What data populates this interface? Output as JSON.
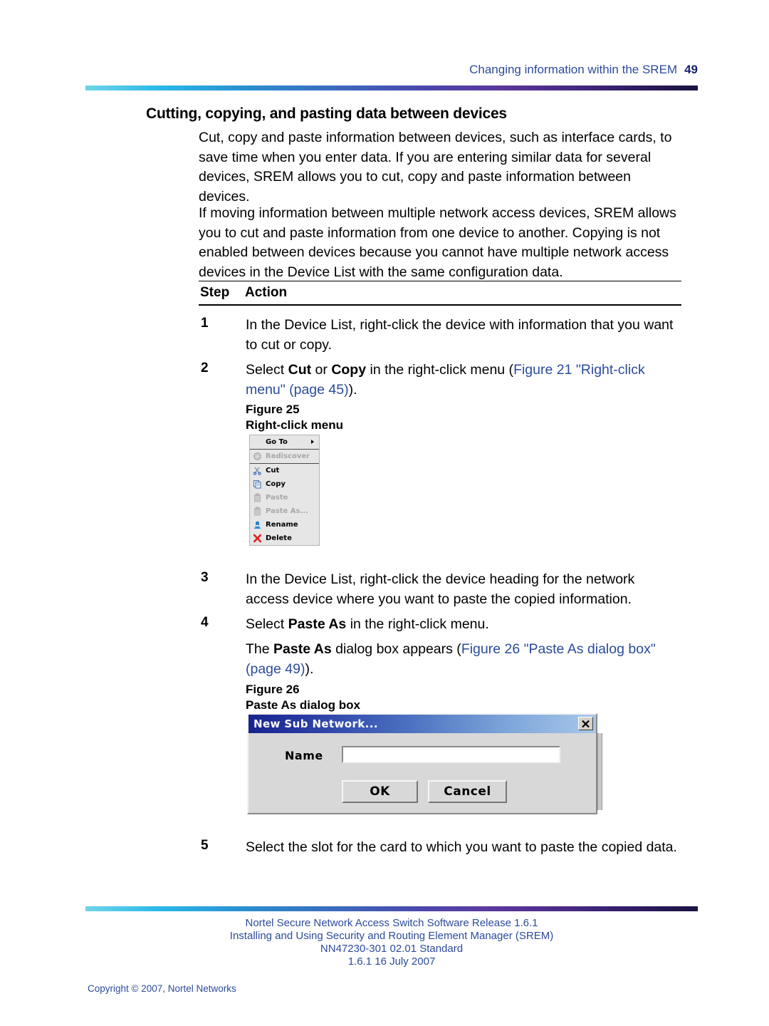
{
  "header": {
    "title": "Changing information within the SREM",
    "page_number": "49"
  },
  "section": {
    "title": "Cutting, copying, and pasting data between devices",
    "paragraph_1": "Cut, copy and paste information between devices, such as interface cards, to save time when you enter data. If you are entering similar data for several devices, SREM allows you to cut, copy and paste information between devices.",
    "paragraph_2": "If moving information between multiple network access devices, SREM allows you to cut and paste information from one device to another. Copying is not enabled between devices because you cannot have multiple network access devices in the Device List with the same configuration data."
  },
  "table": {
    "header_step": "Step",
    "header_action": "Action",
    "steps": [
      {
        "number": "1",
        "text": "In the Device List, right-click the device with information that you want to cut or copy."
      },
      {
        "number": "2",
        "text_lead": "Select ",
        "bold_1": "Cut",
        "text_mid": " or ",
        "bold_2": "Copy",
        "text_tail": " in the right-click menu (",
        "xref": "Figure 21 \"Right-click menu\" (page 45)",
        "text_end": ")."
      },
      {
        "number": "3",
        "text": "In the Device List, right-click the device heading for the network access device where you want to paste the copied information."
      },
      {
        "number": "4",
        "text_lead": "Select ",
        "bold_1": "Paste As",
        "text_tail": " in the right-click menu.",
        "extra_lead": "The ",
        "extra_bold": "Paste As",
        "extra_mid": " dialog box appears (",
        "extra_xref": "Figure 26 \"Paste As dialog box\" (page 49)",
        "extra_end": ")."
      },
      {
        "number": "5",
        "text": "Select the slot for the card to which you want to paste the copied data."
      }
    ]
  },
  "figure_25": {
    "label": "Figure 25",
    "title": "Right-click menu",
    "menu_items": [
      {
        "label": "Go To",
        "icon": "submenu-arrow-icon",
        "disabled": false,
        "has_submenu": true
      },
      {
        "label": "Rediscover",
        "icon": "rediscover-icon",
        "disabled": true,
        "has_submenu": false
      },
      {
        "label": "Cut",
        "icon": "scissors-icon",
        "disabled": false,
        "has_submenu": false
      },
      {
        "label": "Copy",
        "icon": "copy-pages-icon",
        "disabled": false,
        "has_submenu": false
      },
      {
        "label": "Paste",
        "icon": "clipboard-icon",
        "disabled": true,
        "has_submenu": false
      },
      {
        "label": "Paste As...",
        "icon": "clipboard-icon",
        "disabled": true,
        "has_submenu": false
      },
      {
        "label": "Rename",
        "icon": "rename-icon",
        "disabled": false,
        "has_submenu": false
      },
      {
        "label": "Delete",
        "icon": "red-x-icon",
        "disabled": false,
        "has_submenu": false
      }
    ]
  },
  "figure_26": {
    "label": "Figure 26",
    "title": "Paste As dialog box",
    "dialog": {
      "titlebar_text": "New Sub Network...",
      "close_icon": "close-x-icon",
      "name_label": "Name",
      "name_value": "",
      "ok_label": "OK",
      "cancel_label": "Cancel"
    }
  },
  "footer": {
    "line1": "Nortel Secure Network Access Switch Software Release 1.6.1",
    "line2": "Installing and Using Security and Routing Element Manager (SREM)",
    "line3": "NN47230-301   02.01   Standard",
    "line4": "1.6.1   16 July 2007",
    "copyright": "Copyright © 2007, Nortel Networks"
  },
  "colors": {
    "link_blue": "#2a4b9b",
    "header_blue": "#2b4b9b",
    "rule_gradient_start": "#6fd4e8",
    "rule_gradient_end": "#1b1340",
    "dialog_title_dark": "#18248c",
    "dialog_title_light": "#a8c8ea"
  }
}
